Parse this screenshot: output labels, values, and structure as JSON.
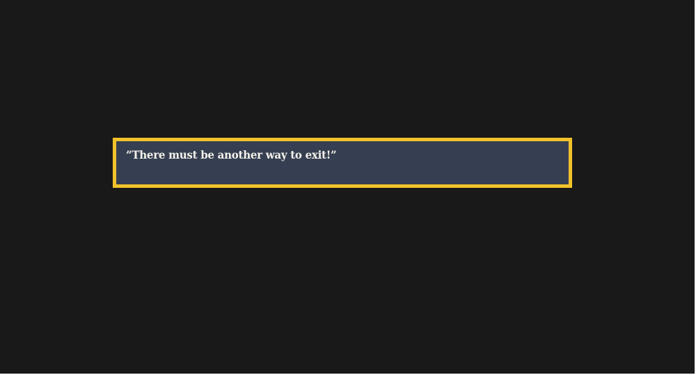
{
  "dialogue": {
    "text": "”There must be another way to exit!”"
  },
  "colors": {
    "screen_background": "#1a1919",
    "dialogue_background": "#363f51",
    "dialogue_border": "#f2c22a",
    "dialogue_text": "#f3f1ea"
  }
}
